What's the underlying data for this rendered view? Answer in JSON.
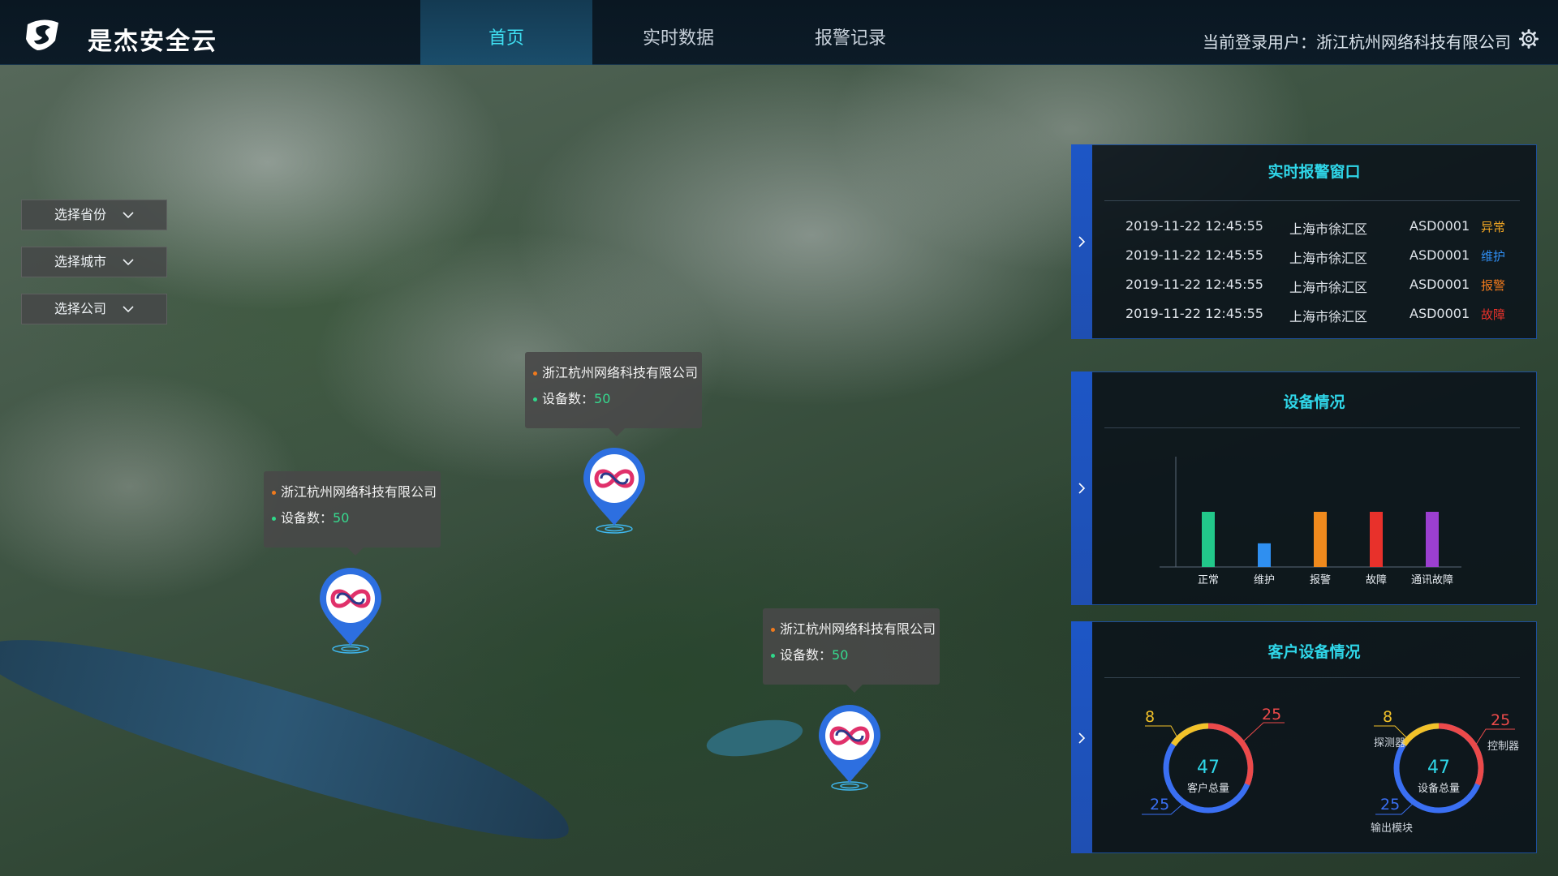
{
  "header": {
    "app_title": "是杰安全云",
    "tabs": [
      {
        "label": "首页",
        "active": true
      },
      {
        "label": "实时数据",
        "active": false
      },
      {
        "label": "报警记录",
        "active": false
      }
    ],
    "user_prefix": "当前登录用户：",
    "user_name": "浙江杭州网络科技有限公司"
  },
  "filters": [
    {
      "label": "选择省份"
    },
    {
      "label": "选择城市"
    },
    {
      "label": "选择公司"
    }
  ],
  "markers": [
    {
      "company": "浙江杭州网络科技有限公司",
      "device_label": "设备数：",
      "device_count": "50"
    },
    {
      "company": "浙江杭州网络科技有限公司",
      "device_label": "设备数：",
      "device_count": "50"
    },
    {
      "company": "浙江杭州网络科技有限公司",
      "device_label": "设备数：",
      "device_count": "50"
    }
  ],
  "alarm_panel": {
    "title": "实时报警窗口",
    "rows": [
      {
        "time": "2019-11-22 12:45:55",
        "location": "上海市徐汇区",
        "id": "ASD0001",
        "status": "异常",
        "color": "#f2a623"
      },
      {
        "time": "2019-11-22 12:45:55",
        "location": "上海市徐汇区",
        "id": "ASD0001",
        "status": "维护",
        "color": "#2f8cf0"
      },
      {
        "time": "2019-11-22 12:45:55",
        "location": "上海市徐汇区",
        "id": "ASD0001",
        "status": "报警",
        "color": "#f27a1d"
      },
      {
        "time": "2019-11-22 12:45:55",
        "location": "上海市徐汇区",
        "id": "ASD0001",
        "status": "故障",
        "color": "#e8312b"
      }
    ]
  },
  "device_panel": {
    "title": "设备情况",
    "chart_data": {
      "type": "bar",
      "categories": [
        "正常",
        "维护",
        "报警",
        "故障",
        "通讯故障"
      ],
      "values": [
        7,
        3,
        7,
        7,
        7
      ],
      "colors": [
        "#22c88a",
        "#2f8ff0",
        "#f08a1d",
        "#e8312b",
        "#9b3fd0"
      ],
      "ylim": [
        0,
        14
      ],
      "grid": false
    }
  },
  "customer_panel": {
    "title": "客户设备情况",
    "rings": [
      {
        "total": "47",
        "label": "客户总量",
        "segments": [
          {
            "value": 8,
            "color": "#f2c229",
            "text": "8",
            "label": ""
          },
          {
            "value": 25,
            "color": "#ec4a4a",
            "text": "25",
            "label": ""
          },
          {
            "value": 25,
            "color": "#3a6ff2",
            "text": "25",
            "label": ""
          }
        ]
      },
      {
        "total": "47",
        "label": "设备总量",
        "segments": [
          {
            "value": 8,
            "color": "#f2c229",
            "text": "8",
            "label": "探测器"
          },
          {
            "value": 25,
            "color": "#ec4a4a",
            "text": "25",
            "label": "控制器"
          },
          {
            "value": 25,
            "color": "#3a6ff2",
            "text": "25",
            "label": "输出模块"
          }
        ]
      }
    ]
  }
}
